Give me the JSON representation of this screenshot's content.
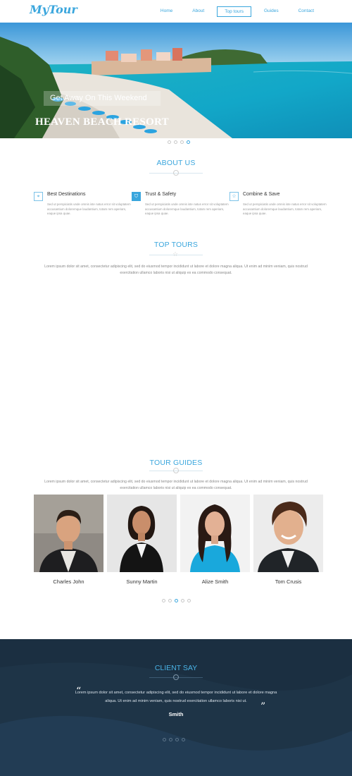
{
  "header": {
    "logo": "MyTour",
    "nav": [
      "Home",
      "About",
      "Top tours",
      "Guides",
      "Contact"
    ],
    "active_nav": "Top tours"
  },
  "hero": {
    "tagline": "Get Away On This Weekend",
    "title": "HEAVEN BEACH RESORT",
    "slide_count": 4,
    "active_slide": 4
  },
  "about": {
    "title": "ABOUT US",
    "features": [
      {
        "icon": "map-pin-icon",
        "title": "Best Destinations",
        "text": "Sed ut perspiciatis unde omnis iste natus error sit voluptatem accusantium doloremque laudantium, totam rem aperiam, eaque ipsa quae."
      },
      {
        "icon": "shield-icon",
        "title": "Trust & Safety",
        "text": "Sed ut perspiciatis unde omnis iste natus error sit voluptatem accusantium doloremque laudantium, totam rem aperiam, eaque ipsa quae."
      },
      {
        "icon": "star-icon",
        "title": "Combine & Save",
        "text": "Sed ut perspiciatis unde omnis iste natus error sit voluptatem accusantium doloremque laudantium, totam rem aperiam, eaque ipsa quae."
      }
    ]
  },
  "top_tours": {
    "title": "TOP TOURS",
    "text": "Lorem ipsum dolor sit amet, consectetur adipiscing elit, sed do eiusmod tempor incididunt ut labore et dolore magna aliqua. Ut enim ad minim veniam, quis nostrud exercitation ullamco laboris nisi ut aliquip ex ea commodo consequat."
  },
  "tour_guides": {
    "title": "TOUR GUIDES",
    "text": "Lorem ipsum dolor sit amet, consectetur adipiscing elit, sed do eiusmod tempor incididunt ut labore et dolore magna aliqua. Ut enim ad minim veniam, quis nostrud exercitation ullamco laboris nisi ut aliquip ex ea commodo consequat.",
    "guides": [
      {
        "name": "Charles John"
      },
      {
        "name": "Sunny Martin"
      },
      {
        "name": "Alize Smith"
      },
      {
        "name": "Tom Crusis"
      }
    ],
    "slide_count": 5,
    "active_slide": 3
  },
  "client": {
    "title": "CLIENT SAY",
    "quote": "Lorem ipsum dolor sit amet, consectetur adipiscing elit, sed do eiusmod tempor incididunt ut labore et dolore magna aliqua. Ut enim ad minim veniam, quis nostrud exercitation ullamco laboris nisi ut.",
    "name": "Smith",
    "slide_count": 4,
    "active_slide": 1
  },
  "colors": {
    "accent": "#3aa6dd",
    "dark_section": "#1e3447"
  }
}
